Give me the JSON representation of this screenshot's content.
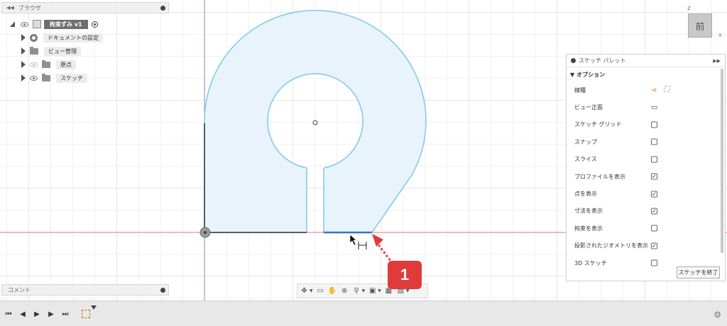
{
  "browser": {
    "title": "ブラウザ",
    "root": "拘束ずみ v1",
    "items": [
      {
        "label": "ドキュメントの設定"
      },
      {
        "label": "ビュー管理"
      },
      {
        "label": "原点"
      },
      {
        "label": "スケッチ"
      }
    ]
  },
  "comment": {
    "label": "コメント"
  },
  "viewcube": {
    "face": "前",
    "axis_z": "Z",
    "axis_x": "X"
  },
  "palette": {
    "title": "スケッチ パレット",
    "section": "オプション",
    "options": [
      {
        "label": "線種",
        "control": "linetype",
        "checked": false
      },
      {
        "label": "ビュー正面",
        "control": "look-at",
        "checked": false
      },
      {
        "label": "スケッチ グリッド",
        "control": "checkbox",
        "checked": false
      },
      {
        "label": "スナップ",
        "control": "checkbox",
        "checked": false
      },
      {
        "label": "スライス",
        "control": "checkbox",
        "checked": false
      },
      {
        "label": "プロファイルを表示",
        "control": "checkbox",
        "checked": true
      },
      {
        "label": "点を表示",
        "control": "checkbox",
        "checked": true
      },
      {
        "label": "寸法を表示",
        "control": "checkbox",
        "checked": true
      },
      {
        "label": "拘束を表示",
        "control": "checkbox",
        "checked": false
      },
      {
        "label": "投影されたジオメトリを表示",
        "control": "checkbox",
        "checked": true
      },
      {
        "label": "3D スケッチ",
        "control": "checkbox",
        "checked": false
      }
    ],
    "finish_button": "スケッチを終了"
  },
  "callout": {
    "number": "1"
  },
  "colors": {
    "profile_fill": "#e8f3fb",
    "profile_stroke": "#7ec8e3",
    "selected_line": "#3a6fd8",
    "callout": "#e03a3a",
    "axis_red": "#e58080",
    "axis_blue": "#8e94d6"
  }
}
